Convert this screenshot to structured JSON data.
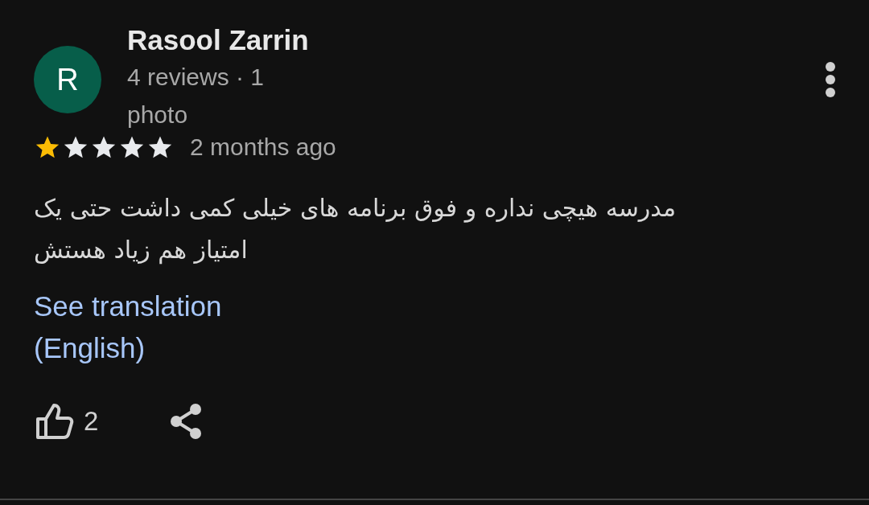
{
  "review": {
    "avatar_letter": "R",
    "author": "Rasool Zarrin",
    "author_meta": "4 reviews · 1 photo",
    "stars": 1,
    "time": "2 months ago",
    "body": "مدرسه هیچی نداره و فوق برنامه های خیلی کمی داشت حتی یک امتیاز هم زیاد هستش",
    "translate_link": "See translation (English)",
    "likes": "2"
  }
}
